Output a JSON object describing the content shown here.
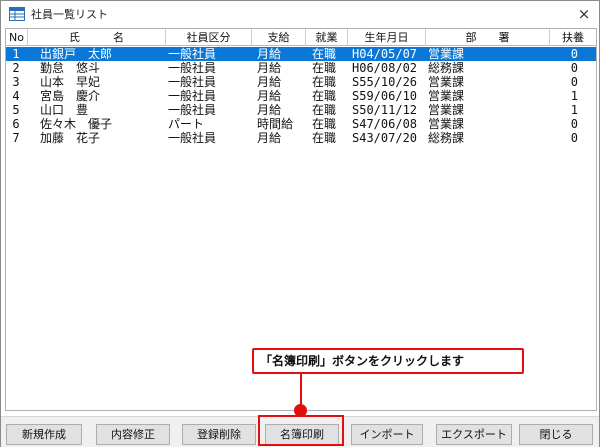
{
  "window": {
    "title": "社員一覧リスト",
    "close_glyph": "×"
  },
  "columns": {
    "no": "No",
    "name": "氏　　　名",
    "category": "社員区分",
    "pay": "支給",
    "status": "就業",
    "birth": "生年月日",
    "dept": "部　　署",
    "dependents": "扶養"
  },
  "rows": [
    {
      "no": "1",
      "name": "出銀戸　太郎",
      "category": "一般社員",
      "pay": "月給",
      "status": "在職",
      "birth": "H04/05/07",
      "dept": "営業課",
      "dependents": "0",
      "selected": true
    },
    {
      "no": "2",
      "name": "勤怠　悠斗",
      "category": "一般社員",
      "pay": "月給",
      "status": "在職",
      "birth": "H06/08/02",
      "dept": "総務課",
      "dependents": "0",
      "selected": false
    },
    {
      "no": "3",
      "name": "山本　早妃",
      "category": "一般社員",
      "pay": "月給",
      "status": "在職",
      "birth": "S55/10/26",
      "dept": "営業課",
      "dependents": "0",
      "selected": false
    },
    {
      "no": "4",
      "name": "宮島　慶介",
      "category": "一般社員",
      "pay": "月給",
      "status": "在職",
      "birth": "S59/06/10",
      "dept": "営業課",
      "dependents": "1",
      "selected": false
    },
    {
      "no": "5",
      "name": "山口　豊",
      "category": "一般社員",
      "pay": "月給",
      "status": "在職",
      "birth": "S50/11/12",
      "dept": "営業課",
      "dependents": "1",
      "selected": false
    },
    {
      "no": "6",
      "name": "佐々木　優子",
      "category": "パート",
      "pay": "時間給",
      "status": "在職",
      "birth": "S47/06/08",
      "dept": "営業課",
      "dependents": "0",
      "selected": false
    },
    {
      "no": "7",
      "name": "加藤　花子",
      "category": "一般社員",
      "pay": "月給",
      "status": "在職",
      "birth": "S43/07/20",
      "dept": "総務課",
      "dependents": "0",
      "selected": false
    }
  ],
  "callout": {
    "text": "「名簿印刷」ボタンをクリックします"
  },
  "buttons": {
    "new": "新規作成",
    "edit": "内容修正",
    "delete": "登録削除",
    "print": "名簿印刷",
    "import": "インポート",
    "export": "エクスポート",
    "close": "閉じる"
  },
  "colors": {
    "selection": "#0b78d7",
    "accent_red": "#e01010"
  },
  "icons": {
    "app": "table-window-icon",
    "close": "close-icon"
  }
}
